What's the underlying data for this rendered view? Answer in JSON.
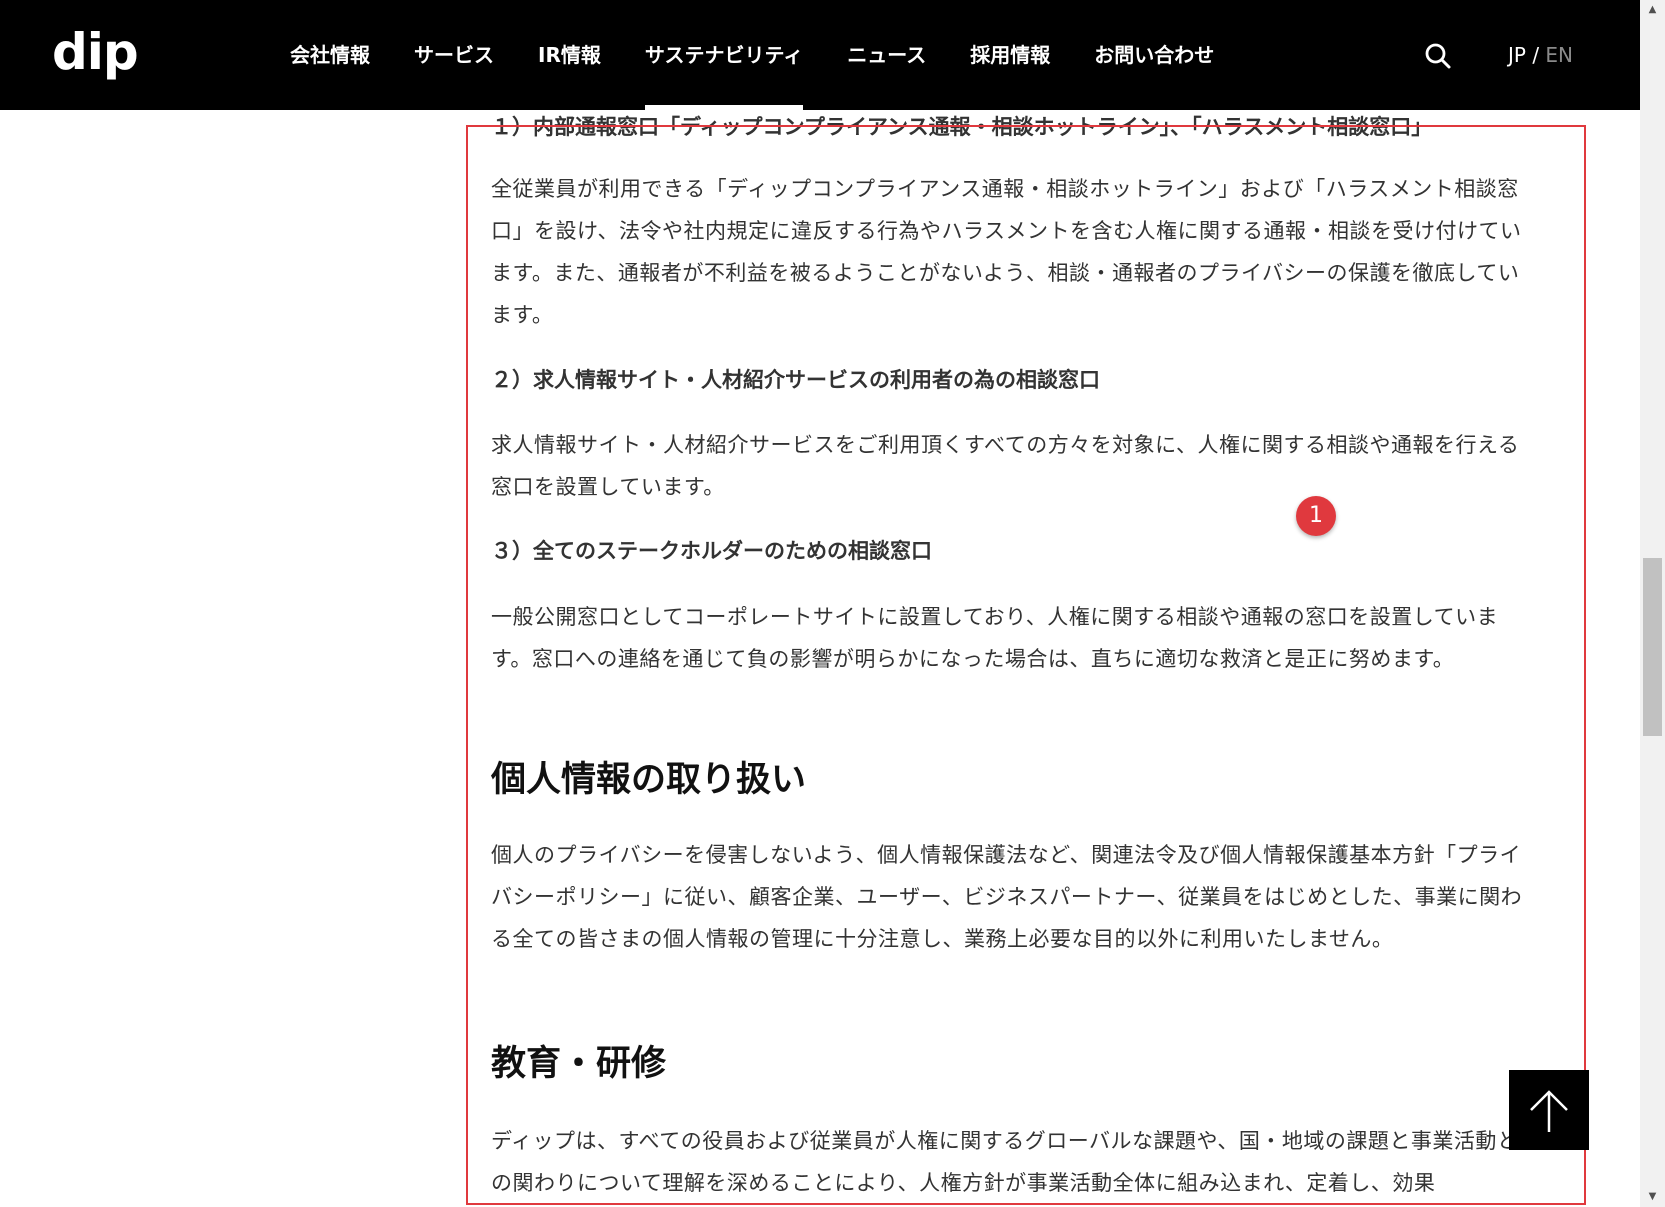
{
  "header": {
    "logo": "dip",
    "nav": [
      "会社情報",
      "サービス",
      "IR情報",
      "サステナビリティ",
      "ニュース",
      "採用情報",
      "お問い合わせ"
    ],
    "active_nav": "サステナビリティ",
    "lang_jp": "JP",
    "lang_sep": " / ",
    "lang_en": "EN"
  },
  "content": {
    "sub1_title": "１）内部通報窓口「ディップコンプライアンス通報・相談ホットライン」、「ハラスメント相談窓口」",
    "sub1_text": "全従業員が利用できる「ディップコンプライアンス通報・相談ホットライン」および「ハラスメント相談窓口」を設け、法令や社内規定に違反する行為やハラスメントを含む人権に関する通報・相談を受け付けています。また、通報者が不利益を被るようことがないよう、相談・通報者のプライバシーの保護を徹底しています。",
    "sub2_title": "２）求人情報サイト・人材紹介サービスの利用者の為の相談窓口",
    "sub2_text": "求人情報サイト・人材紹介サービスをご利用頂くすべての方々を対象に、人権に関する相談や通報を行える窓口を設置しています。",
    "sub3_title": "３）全てのステークホルダーのための相談窓口",
    "sub3_text": "一般公開窓口としてコーポレートサイトに設置しており、人権に関する相談や通報の窓口を設置しています。窓口への連絡を通じて負の影響が明らかになった場合は、直ちに適切な救済と是正に努めます。",
    "privacy_heading": "個人情報の取り扱い",
    "privacy_text": "個人のプライバシーを侵害しないよう、個人情報保護法など、関連法令及び個人情報保護基本方針「プライバシーポリシー」に従い、顧客企業、ユーザー、ビジネスパートナー、従業員をはじめとした、事業に関わる全ての皆さまの個人情報の管理に十分注意し、業務上必要な目的以外に利用いたしません。",
    "training_heading": "教育・研修",
    "training_text": "ディップは、すべての役員および従業員が人権に関するグローバルな課題や、国・地域の課題と事業活動との関わりについて理解を深めることにより、人権方針が事業活動全体に組み込まれ、定着し、効果"
  },
  "annotation": {
    "badge_label": "1",
    "color": "#e0393e"
  }
}
